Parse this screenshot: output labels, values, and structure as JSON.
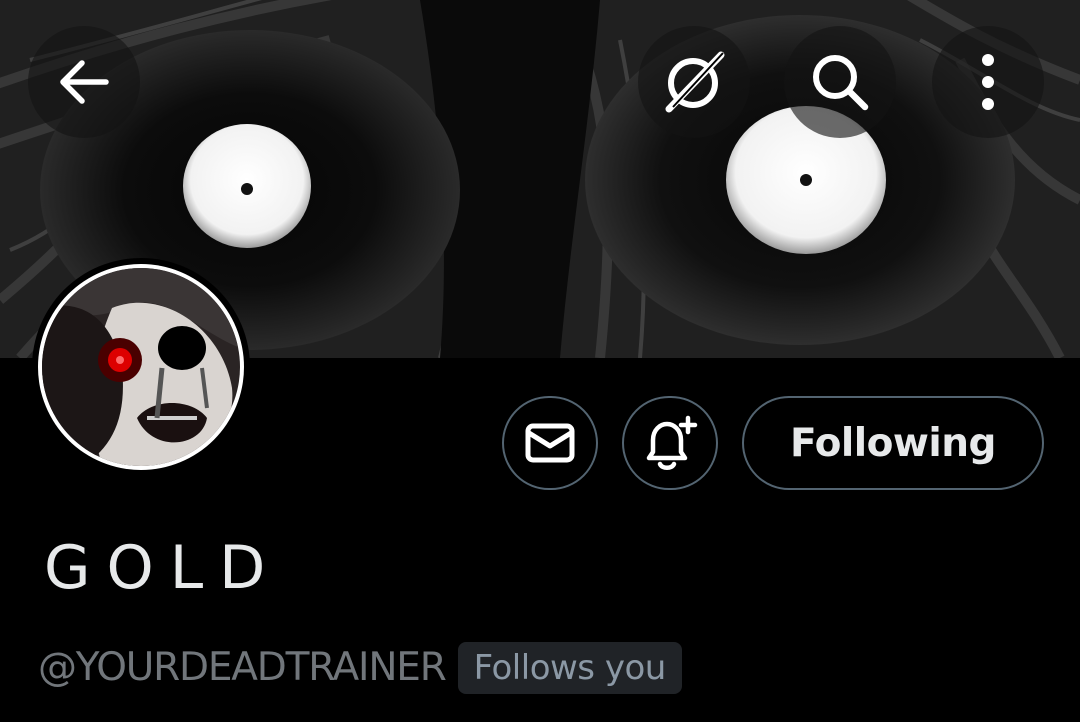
{
  "header": {
    "back_icon": "arrow-left-icon",
    "grok_icon": "grok-slash-icon",
    "search_icon": "search-icon",
    "more_icon": "more-vertical-icon"
  },
  "profile": {
    "display_name": "GOLD",
    "handle": "@YOURDEADTRAINER",
    "follows_you_badge": "Follows you"
  },
  "actions": {
    "message_icon": "envelope-icon",
    "notify_icon": "bell-plus-icon",
    "following_label": "Following"
  },
  "colors": {
    "background": "#000000",
    "text_primary": "#e7e9ea",
    "text_secondary": "#71767b",
    "button_border": "#536471",
    "badge_bg": "#202327"
  }
}
